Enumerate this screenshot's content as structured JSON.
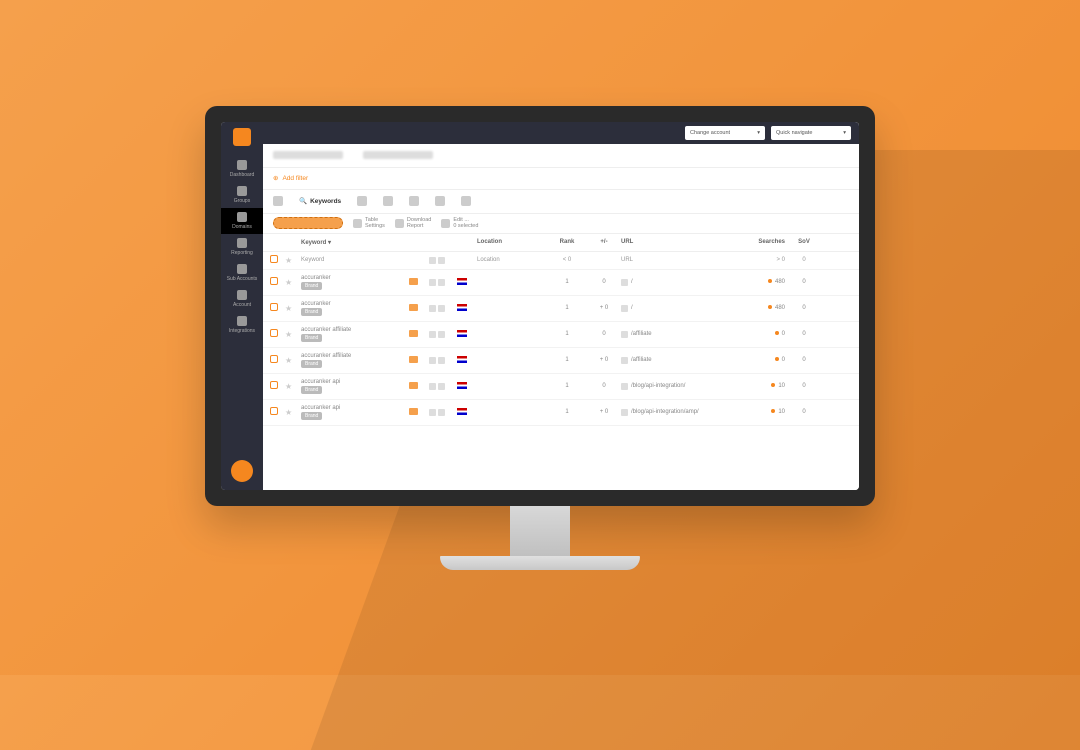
{
  "header": {
    "change_account": "Change account",
    "quick_navigate": "Quick navigate"
  },
  "sidebar": {
    "items": [
      {
        "label": "Dashboard"
      },
      {
        "label": "Groups"
      },
      {
        "label": "Domains"
      },
      {
        "label": "Reporting"
      },
      {
        "label": "Sub Accounts"
      },
      {
        "label": "Account"
      },
      {
        "label": "Integrations"
      }
    ]
  },
  "filter": {
    "add": "Add filter"
  },
  "tabs": {
    "active": "Keywords"
  },
  "toolbar": {
    "settings": "Settings",
    "settings_sub": "Table",
    "report": "Report",
    "report_sub": "Download",
    "edit": "0 selected",
    "edit_sub": "Edit ..."
  },
  "columns": {
    "keyword": "Keyword ▾",
    "location": "Location",
    "rank": "Rank",
    "pm": "+/-",
    "url": "URL",
    "searches": "Searches",
    "sov": "SoV"
  },
  "filters_row": {
    "keyword": "Keyword",
    "location": "Location",
    "rank": "0",
    "url": "URL",
    "searches": "0",
    "sov": "0"
  },
  "rows": [
    {
      "kw": "accuranker",
      "tag": "Brand",
      "rank": "1",
      "pm": "0",
      "url": "/",
      "searches": "480",
      "sov": "0"
    },
    {
      "kw": "accuranker",
      "tag": "Brand",
      "rank": "1",
      "pm": "0",
      "url": "/",
      "searches": "480",
      "sov": "0"
    },
    {
      "kw": "accuranker affiliate",
      "tag": "Brand",
      "rank": "1",
      "pm": "0",
      "url": "/affiliate",
      "searches": "0",
      "sov": "0"
    },
    {
      "kw": "accuranker affiliate",
      "tag": "Brand",
      "rank": "1",
      "pm": "0",
      "url": "/affiliate",
      "searches": "0",
      "sov": "0"
    },
    {
      "kw": "accuranker api",
      "tag": "Brand",
      "rank": "1",
      "pm": "0",
      "url": "/blog/api-integration/",
      "searches": "10",
      "sov": "0"
    },
    {
      "kw": "accuranker api",
      "tag": "Brand",
      "rank": "1",
      "pm": "0",
      "url": "/blog/api-integration/amp/",
      "searches": "10",
      "sov": "0"
    }
  ]
}
